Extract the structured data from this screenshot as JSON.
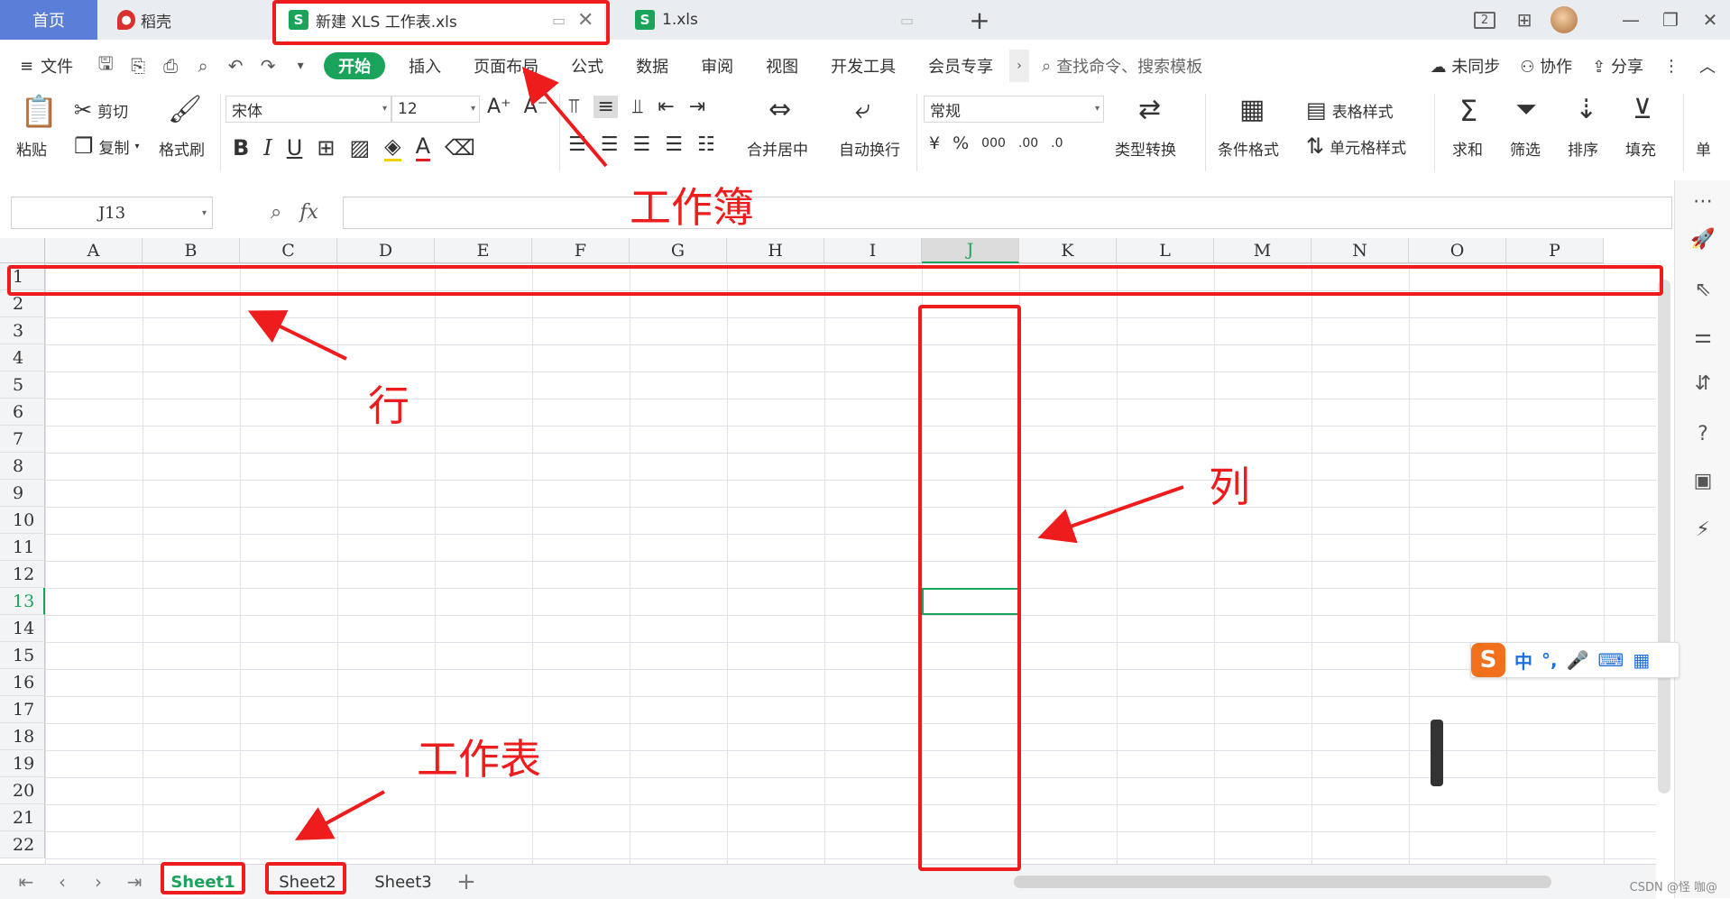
{
  "tabs": {
    "home": "首页",
    "docer": "稻壳",
    "active_file": "新建 XLS 工作表.xls",
    "second_file": "1.xls",
    "s_logo": "S",
    "add_tab": "+"
  },
  "titlebar_icons": {
    "page_badge": "2"
  },
  "menu": {
    "file": "文件",
    "items": [
      "开始",
      "插入",
      "页面布局",
      "公式",
      "数据",
      "审阅",
      "视图",
      "开发工具",
      "会员专享"
    ],
    "search_placeholder": "查找命令、搜索模板",
    "sync": "未同步",
    "collab": "协作",
    "share": "分享"
  },
  "ribbon": {
    "paste": "粘贴",
    "cut": "剪切",
    "copy": "复制",
    "format_painter": "格式刷",
    "font_name": "宋体",
    "font_size": "12",
    "merge_center": "合并居中",
    "wrap_text": "自动换行",
    "number_format": "常规",
    "type_convert": "类型转换",
    "conditional_format": "条件格式",
    "table_style": "表格样式",
    "cell_style": "单元格样式",
    "sum": "求和",
    "filter": "筛选",
    "sort": "排序",
    "fill": "填充",
    "single": "单",
    "currency": "¥",
    "percent": "%",
    "thousands": "000",
    "dec_inc": ".00",
    "dec_dec": ".0",
    "bold": "B",
    "italic": "I",
    "underline": "U",
    "font_color": "A"
  },
  "formula_bar": {
    "cell_ref": "J13",
    "fx": "fx"
  },
  "columns": [
    "A",
    "B",
    "C",
    "D",
    "E",
    "F",
    "G",
    "H",
    "I",
    "J",
    "K",
    "L",
    "M",
    "N",
    "O",
    "P"
  ],
  "selected_column": "J",
  "rows": [
    "1",
    "2",
    "3",
    "4",
    "5",
    "6",
    "7",
    "8",
    "9",
    "10",
    "11",
    "12",
    "13",
    "14",
    "15",
    "16",
    "17",
    "18",
    "19",
    "20",
    "21",
    "22"
  ],
  "selected_row": "13",
  "sheets": [
    "Sheet1",
    "Sheet2",
    "Sheet3"
  ],
  "active_sheet": "Sheet1",
  "ime": {
    "mode": "中",
    "punct": "°,"
  },
  "annotations": {
    "workbook": "工作簿",
    "row": "行",
    "column": "列",
    "worksheet": "工作表"
  },
  "watermark": "CSDN @怪 咖@",
  "colors": {
    "accent_green": "#1aa35b",
    "home_tab_blue": "#5b7fd8",
    "annotation_red": "#ee1c1c"
  }
}
